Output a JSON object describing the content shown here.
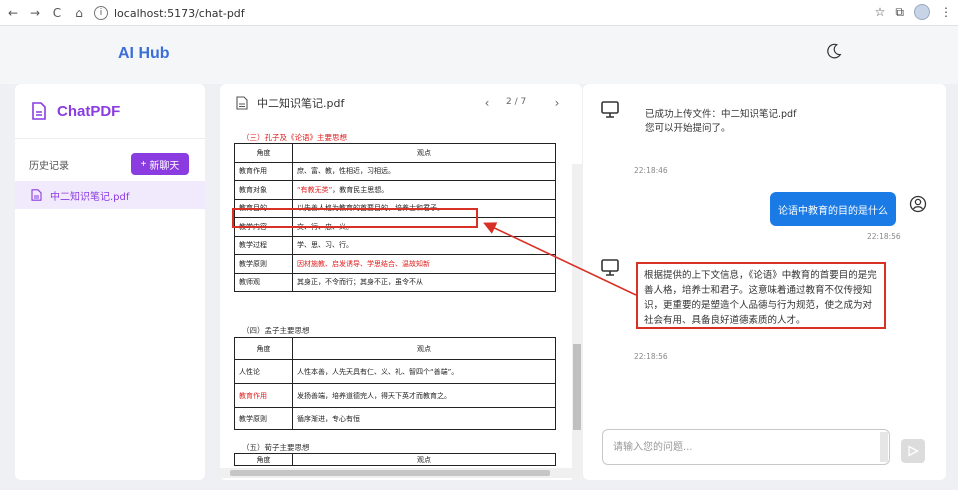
{
  "browser": {
    "back": "←",
    "forward": "→",
    "reload": "C",
    "home": "⌂",
    "url": "localhost:5173/chat-pdf",
    "star": "☆",
    "ext": "⧉",
    "menu": "⋮"
  },
  "header": {
    "title": "AI Hub"
  },
  "sidebar": {
    "brand": "ChatPDF",
    "history_label": "历史记录",
    "new_chat_label": "新聊天",
    "new_chat_plus": "+",
    "items": [
      {
        "label": "中二知识笔记.pdf"
      }
    ]
  },
  "pdf": {
    "file_name": "中二知识笔记.pdf",
    "page_indicator": "2 / 7",
    "prev": "‹",
    "next": "›",
    "sections": [
      {
        "title": "（三）孔子及《论语》主要思想",
        "title_red": true,
        "header": [
          "角度",
          "观点"
        ],
        "rows": [
          {
            "k": "教育作用",
            "v": "庶、富、教，性相近，习相远。",
            "red": false
          },
          {
            "k": "教育对象",
            "v": "“有教无类”，教育民主思想。",
            "red": false,
            "v_red_part": "“有教无类”"
          },
          {
            "k": "教育目的",
            "v": "以先善人格为教育的首要目的，培养士和君子。",
            "red": false
          },
          {
            "k": "教学内容",
            "v": "文、行、忠、义。",
            "red": false
          },
          {
            "k": "教学过程",
            "v": "学、思、习、行。",
            "red": false
          },
          {
            "k": "教学原则",
            "v": "因材施教、启发诱导、学思结合、温故知新",
            "red": true
          },
          {
            "k": "教师观",
            "v": "其身正，不令而行；其身不正，虽令不从",
            "red": false
          }
        ]
      },
      {
        "title": "（四）孟子主要思想",
        "title_red": false,
        "header": [
          "角度",
          "观点"
        ],
        "rows": [
          {
            "k": "人性论",
            "v": "人性本善，人先天具有仁、义、礼、智四个“善端”。",
            "red": false
          },
          {
            "k": "教育作用",
            "v": "发扬善端，培养道德完人，得天下英才而教育之。",
            "red": false,
            "k_red": true
          },
          {
            "k": "教学原则",
            "v": "循序渐进，专心有恒",
            "red": false
          }
        ]
      },
      {
        "title": "（五）荀子主要思想",
        "title_red": false,
        "header": [
          "角度",
          "观点"
        ],
        "rows": []
      }
    ]
  },
  "chat": {
    "messages": [
      {
        "role": "bot",
        "lines": [
          "已成功上传文件：中二知识笔记.pdf",
          "您可以开始提问了。"
        ],
        "time": "22:18:46"
      },
      {
        "role": "user",
        "text": "论语中教育的目的是什么",
        "time": "22:18:56"
      },
      {
        "role": "bot",
        "text": "根据提供的上下文信息，《论语》中教育的首要目的是完善人格，培养士和君子。这意味着通过教育不仅传授知识，更重要的是塑造个人品德与行为规范，使之成为对社会有用、具备良好道德素质的人才。",
        "time": "22:18:56"
      }
    ],
    "input_placeholder": "请输入您的问题...",
    "send": "▷"
  },
  "colors": {
    "accent": "#8a3ce0",
    "brand_blue": "#3b6fd8",
    "user_bubble": "#1a7be6",
    "highlight": "#d93025"
  }
}
